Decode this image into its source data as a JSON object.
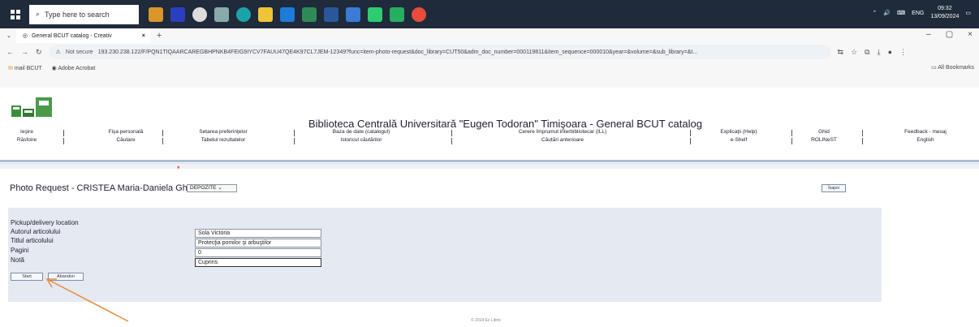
{
  "taskbar": {
    "search_placeholder": "Type here to search",
    "lang": "ENG",
    "time": "09:32",
    "date": "13/09/2024"
  },
  "browser": {
    "tab_title": "General BCUT catalog - Creativ",
    "security_label": "Not secure",
    "url": "193.230.238.122/F/PQN1TIQAARCAREGBHPNKB4FEIG9IYCV7FAUU47QE4K97CL7JEM-12349?func=item-photo-request&doc_library=CUT50&adm_doc_number=000119811&item_sequence=000010&year=&volume=&sub_library=&t...",
    "bookmarks": [
      "mail BCUT",
      "Adobe Acrobat"
    ],
    "all_bookmarks": "All Bookmarks"
  },
  "site": {
    "title": "Biblioteca Centrală Universitară \"Eugen Todoran\" Timişoara - General BCUT catalog",
    "nav": [
      {
        "top": "Ieşire",
        "bottom": "Răsfoire"
      },
      {
        "top": "Fişa personală",
        "bottom": "Căutare"
      },
      {
        "top": "Setarea preferinţelor",
        "bottom": "Tabelul rezultatelor"
      },
      {
        "top": "Baza de date (catalogul)",
        "bottom": "Istoricul căutărilor"
      },
      {
        "top": "Cerere împrumut interbibliotecar (ILL)",
        "bottom": "Căutări anterioare"
      },
      {
        "top": "Explicaţii (Help)",
        "bottom": "e-Shelf"
      },
      {
        "top": "Ghid",
        "bottom": "ROLINeST"
      },
      {
        "top": "Feedback - mesaj",
        "bottom": "English"
      }
    ]
  },
  "form": {
    "heading": "Photo Request - CRISTEA Maria-Daniela Gh.",
    "back_label": "Înapoi",
    "pickup_label": "Pickup/delivery location",
    "pickup_value": "DEPOZITE",
    "author_label": "Autorul articolului",
    "author_value": "Sola Victoria",
    "title_label": "Titlul articolului",
    "title_value": "Protecţia pomilor şi arbuştilor",
    "pages_label": "Pagini",
    "pages_value": "0",
    "note_label": "Notă",
    "note_value": "Cuprins",
    "submit_label": "Start",
    "cancel_label": "Abandon"
  },
  "footer": "© 2014 Ex Libris",
  "colors": {
    "arrow": "#e8893e",
    "form_bg": "#e5e9f1",
    "header_rule": "#a9bcd2"
  }
}
